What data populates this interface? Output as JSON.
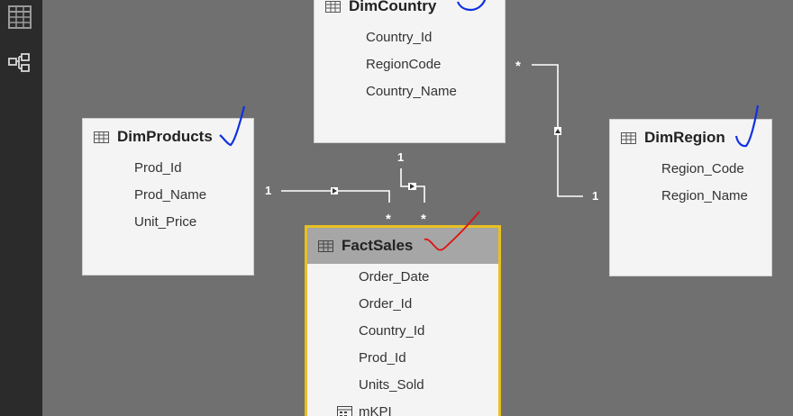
{
  "sidebar": {
    "items": [
      {
        "icon": "data-grid-icon"
      },
      {
        "icon": "relationships-icon"
      }
    ]
  },
  "tables": {
    "dimcountry": {
      "title": "DimCountry",
      "fields": [
        "Country_Id",
        "RegionCode",
        "Country_Name"
      ]
    },
    "dimproducts": {
      "title": "DimProducts",
      "fields": [
        "Prod_Id",
        "Prod_Name",
        "Unit_Price"
      ]
    },
    "dimregion": {
      "title": "DimRegion",
      "fields": [
        "Region_Code",
        "Region_Name"
      ]
    },
    "factsales": {
      "title": "FactSales",
      "fields": [
        "Order_Date",
        "Order_Id",
        "Country_Id",
        "Prod_Id",
        "Units_Sold",
        "mKPI"
      ]
    }
  },
  "relationships": {
    "products_one": "1",
    "products_many": "*",
    "country_one": "1",
    "country_many": "*",
    "region_one": "1",
    "region_many": "*"
  },
  "colors": {
    "canvas": "#707070",
    "sidebar": "#2b2b2b",
    "selected_border": "#e8c020",
    "annotation_blue": "#1030e0",
    "annotation_red": "#e01010"
  }
}
